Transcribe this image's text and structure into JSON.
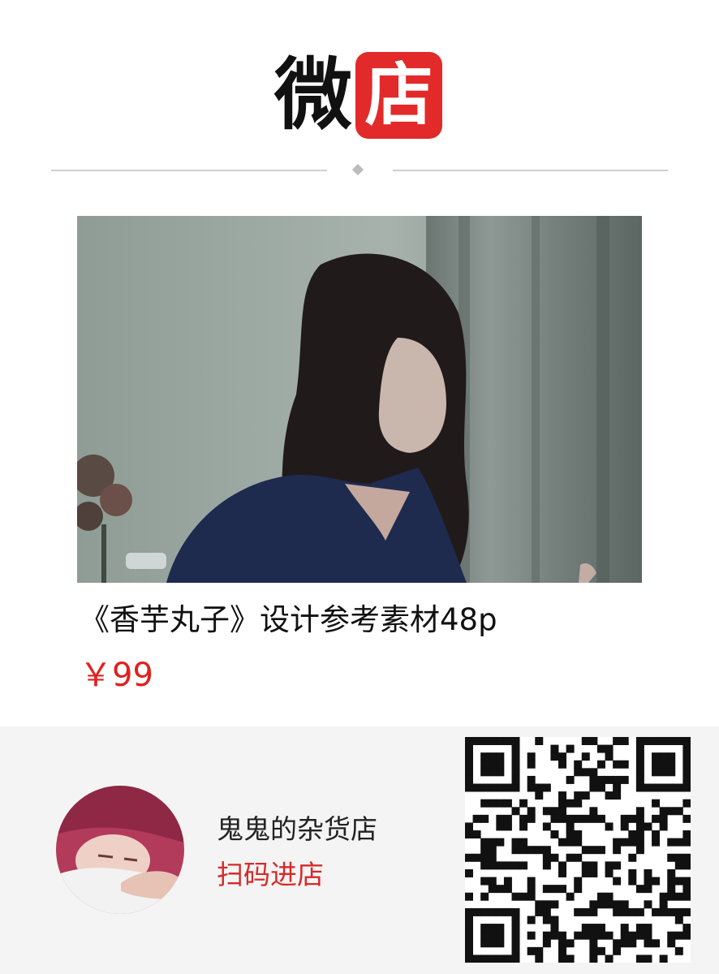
{
  "brand": {
    "logo_char_1": "微",
    "logo_char_2": "店",
    "accent_color": "#e22a2a"
  },
  "product": {
    "image_icon": "product-photo",
    "title": "《香芋丸子》设计参考素材48p",
    "price": "￥99"
  },
  "shop": {
    "avatar_icon": "shop-avatar",
    "name": "鬼鬼的杂货店",
    "cta": "扫码进店",
    "cta_color": "#d62a2a",
    "qr_icon": "qr-code"
  }
}
